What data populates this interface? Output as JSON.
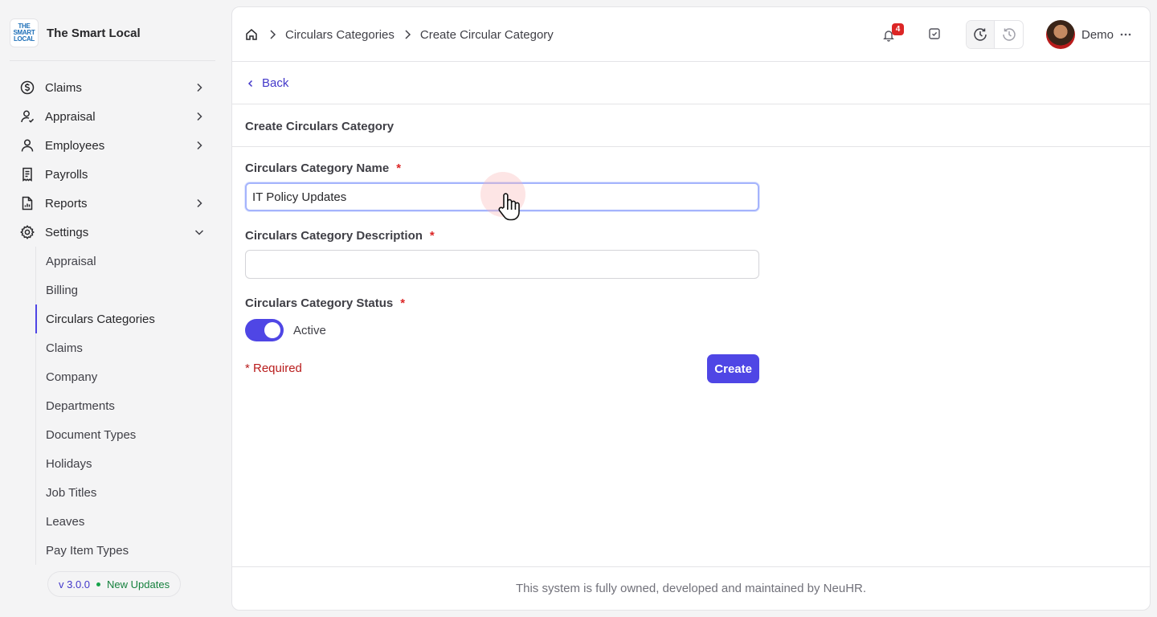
{
  "brand": {
    "logo_lines": [
      "THE",
      "SMART",
      "LOCAL"
    ],
    "name": "The Smart Local"
  },
  "sidebar": {
    "items": [
      {
        "label": "Claims",
        "icon": "dollar-circle-icon",
        "expandable": true
      },
      {
        "label": "Appraisal",
        "icon": "user-check-icon",
        "expandable": true
      },
      {
        "label": "Employees",
        "icon": "user-icon",
        "expandable": true
      },
      {
        "label": "Payrolls",
        "icon": "receipt-icon",
        "expandable": false
      },
      {
        "label": "Reports",
        "icon": "report-file-icon",
        "expandable": true
      },
      {
        "label": "Settings",
        "icon": "gear-icon",
        "expandable": true,
        "expanded": true
      }
    ],
    "settings_items": [
      "Appraisal",
      "Billing",
      "Circulars Categories",
      "Claims",
      "Company",
      "Departments",
      "Document Types",
      "Holidays",
      "Job Titles",
      "Leaves",
      "Pay Item Types"
    ],
    "active_settings_item": "Circulars Categories",
    "version": "v 3.0.0",
    "updates_label": "New Updates"
  },
  "header": {
    "breadcrumbs": [
      "Circulars Categories",
      "Create Circular Category"
    ],
    "notification_count": "4",
    "user_name": "Demo"
  },
  "page": {
    "back_label": "Back",
    "title": "Create Circulars Category"
  },
  "form": {
    "name_label": "Circulars Category Name",
    "name_value": "IT Policy Updates",
    "description_label": "Circulars Category Description",
    "description_value": "",
    "status_label": "Circulars Category Status",
    "status_value": "Active",
    "required_marker": "*",
    "required_note": "* Required",
    "submit_label": "Create"
  },
  "footer": {
    "text": "This system is fully owned, developed and maintained by NeuHR."
  },
  "colors": {
    "accent": "#4f46e5",
    "link": "#4338ca",
    "required": "#b91c1c",
    "badge": "#dc2626"
  }
}
